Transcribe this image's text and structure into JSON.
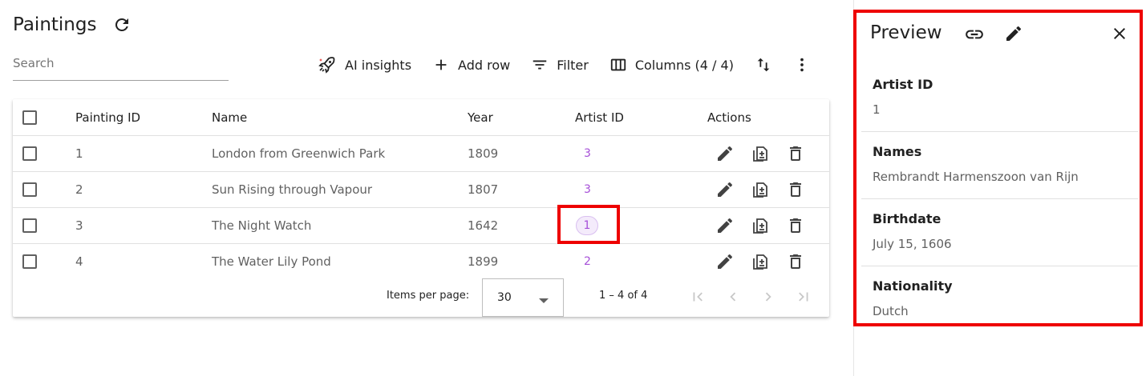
{
  "page": {
    "title": "Paintings"
  },
  "search": {
    "placeholder": "Search"
  },
  "toolbar": {
    "ai_insights": "AI insights",
    "add_row": "Add row",
    "filter": "Filter",
    "columns": "Columns (4 / 4)"
  },
  "table": {
    "headers": {
      "painting_id": "Painting ID",
      "name": "Name",
      "year": "Year",
      "artist_id": "Artist ID",
      "actions": "Actions"
    },
    "rows": [
      {
        "painting_id": "1",
        "name": "London from Greenwich Park",
        "year": "1809",
        "artist_id": "3"
      },
      {
        "painting_id": "2",
        "name": "Sun Rising through Vapour",
        "year": "1807",
        "artist_id": "3"
      },
      {
        "painting_id": "3",
        "name": "The Night Watch",
        "year": "1642",
        "artist_id": "1"
      },
      {
        "painting_id": "4",
        "name": "The Water Lily Pond",
        "year": "1899",
        "artist_id": "2"
      }
    ]
  },
  "paginator": {
    "items_per_page_label": "Items per page:",
    "page_size": "30",
    "range": "1 – 4 of 4"
  },
  "preview": {
    "title": "Preview",
    "fields": [
      {
        "label": "Artist ID",
        "value": "1"
      },
      {
        "label": "Names",
        "value": "Rembrandt Harmenszoon van Rijn"
      },
      {
        "label": "Birthdate",
        "value": "July 15, 1606"
      },
      {
        "label": "Nationality",
        "value": "Dutch"
      }
    ]
  },
  "colors": {
    "link": "#a64fd8",
    "highlight": "#ee0000",
    "text": "#212121",
    "muted": "#616161"
  }
}
